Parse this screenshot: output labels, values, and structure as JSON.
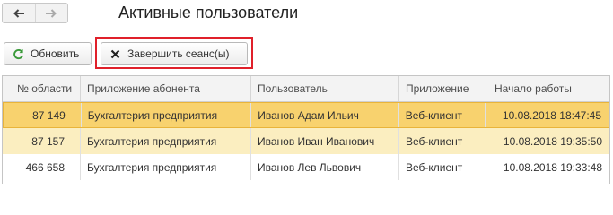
{
  "window": {
    "title": "Активные пользователи"
  },
  "nav": {
    "back_icon": "arrow-left-icon",
    "forward_icon": "arrow-right-icon"
  },
  "toolbar": {
    "refresh_label": "Обновить",
    "end_session_label": "Завершить сеанс(ы)",
    "refresh_icon_color": "#3a9a3a",
    "highlight_color": "#e0202a"
  },
  "table": {
    "columns": [
      "№ области",
      "Приложение абонента",
      "Пользователь",
      "Приложение",
      "Начало работы"
    ],
    "rows": [
      {
        "area": "87 149",
        "app_subscriber": "Бухгалтерия предприятия",
        "user": "Иванов  Адам Ильич",
        "app": "Веб-клиент",
        "start": "10.08.2018 18:47:45",
        "state": "selected"
      },
      {
        "area": "87 157",
        "app_subscriber": "Бухгалтерия предприятия",
        "user": "Иванов Иван Иванович",
        "app": "Веб-клиент",
        "start": "10.08.2018 19:35:50",
        "state": "highlighted"
      },
      {
        "area": "466 658",
        "app_subscriber": "Бухгалтерия предприятия",
        "user": "Иванов Лев Львович",
        "app": "Веб-клиент",
        "start": "10.08.2018 19:33:48",
        "state": "normal"
      }
    ]
  },
  "colors": {
    "selected_row": "#f8d26e",
    "highlighted_row": "#fbeec0"
  }
}
